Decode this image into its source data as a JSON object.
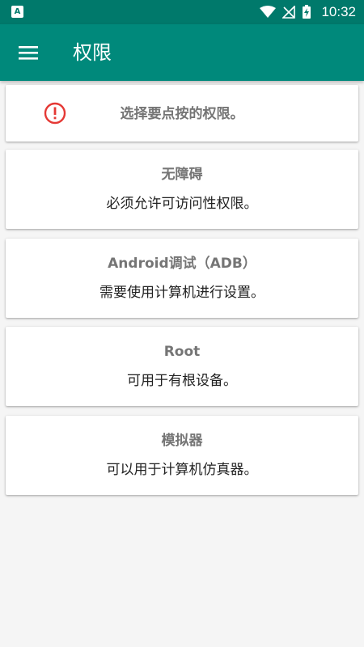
{
  "status_bar": {
    "left_icon_letter": "A",
    "time": "10:32"
  },
  "app_bar": {
    "title": "权限"
  },
  "info": {
    "text": "选择要点按的权限。"
  },
  "options": [
    {
      "title": "无障碍",
      "description": "必须允许可访问性权限。"
    },
    {
      "title": "Android调试（ADB）",
      "description": "需要使用计算机进行设置。"
    },
    {
      "title": "Root",
      "description": "可用于有根设备。"
    },
    {
      "title": "模拟器",
      "description": "可以用于计算机仿真器。"
    }
  ],
  "colors": {
    "primary": "#00897b",
    "primary_dark": "#00796b",
    "info_icon": "#e53935"
  }
}
